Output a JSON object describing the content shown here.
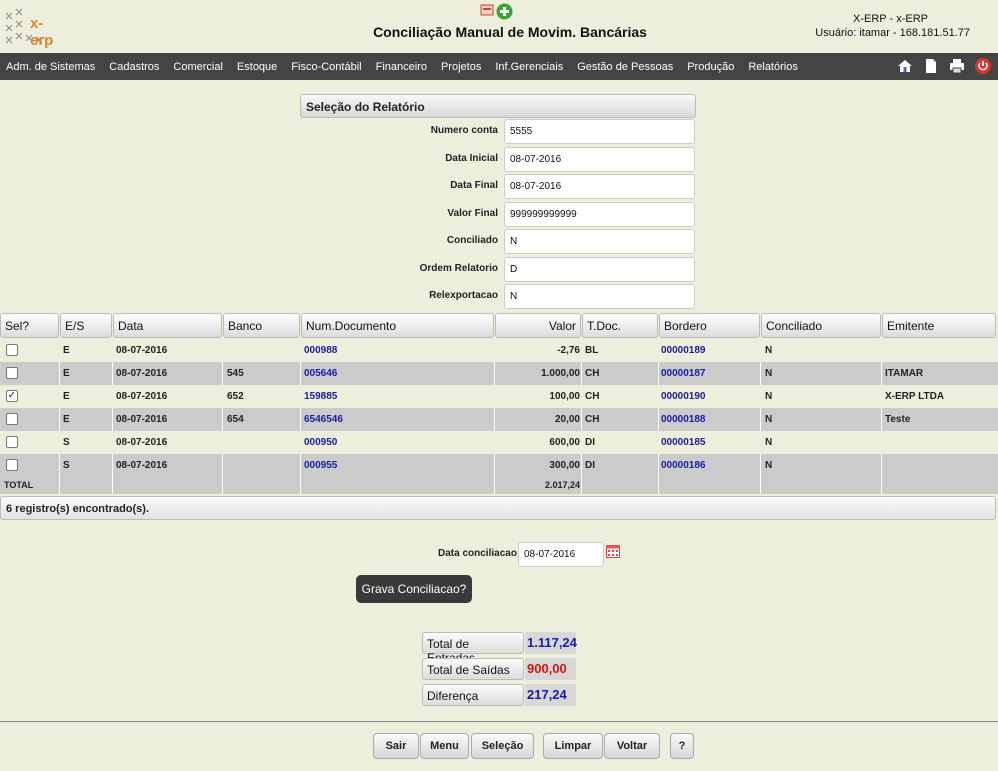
{
  "header": {
    "logo_text": "x-erp",
    "title": "Conciliação Manual de Movim. Bancárias",
    "system": "X-ERP - x-ERP",
    "user": "Usuário: itamar - 168.181.51.77"
  },
  "menu": [
    "Adm. de Sistemas",
    "Cadastros",
    "Comercial",
    "Estoque",
    "Fisco-Contábil",
    "Financeiro",
    "Projetos",
    "Inf.Gerenciais",
    "Gestão de Pessoas",
    "Produção",
    "Relatórios"
  ],
  "section_title": "Seleção do Relatório",
  "form": {
    "numero_conta_label": "Numero conta",
    "numero_conta": "5555",
    "data_inicial_label": "Data Inicial",
    "data_inicial": "08-07-2016",
    "data_final_label": "Data Final",
    "data_final": "08-07-2016",
    "valor_final_label": "Valor Final",
    "valor_final": "999999999999",
    "conciliado_label": "Conciliado",
    "conciliado": "N",
    "ordem_label": "Ordem Relatorio",
    "ordem": "D",
    "relexp_label": "Relexportacao",
    "relexp": "N"
  },
  "table": {
    "headers": [
      "Sel?",
      "E/S",
      "Data",
      "Banco",
      "Num.Documento",
      "Valor",
      "T.Doc.",
      "Bordero",
      "Conciliado",
      "Emitente"
    ],
    "rows": [
      {
        "checked": "",
        "es": "E",
        "data": "08-07-2016",
        "banco": "",
        "doc": "000988",
        "valor": "-2,76",
        "tdoc": "BL",
        "bordero": "00000189",
        "conciliado": "N",
        "emitente": ""
      },
      {
        "checked": "",
        "es": "E",
        "data": "08-07-2016",
        "banco": "545",
        "doc": "005646",
        "valor": "1.000,00",
        "tdoc": "CH",
        "bordero": "00000187",
        "conciliado": "N",
        "emitente": "ITAMAR"
      },
      {
        "checked": "✓",
        "es": "E",
        "data": "08-07-2016",
        "banco": "652",
        "doc": "159885",
        "valor": "100,00",
        "tdoc": "CH",
        "bordero": "00000190",
        "conciliado": "N",
        "emitente": "X-ERP LTDA"
      },
      {
        "checked": "",
        "es": "E",
        "data": "08-07-2016",
        "banco": "654",
        "doc": "6546546",
        "valor": "20,00",
        "tdoc": "CH",
        "bordero": "00000188",
        "conciliado": "N",
        "emitente": "Teste"
      },
      {
        "checked": "",
        "es": "S",
        "data": "08-07-2016",
        "banco": "",
        "doc": "000950",
        "valor": "600,00",
        "tdoc": "DI",
        "bordero": "00000185",
        "conciliado": "N",
        "emitente": ""
      },
      {
        "checked": "",
        "es": "S",
        "data": "08-07-2016",
        "banco": "",
        "doc": "000955",
        "valor": "300,00",
        "tdoc": "DI",
        "bordero": "00000186",
        "conciliado": "N",
        "emitente": ""
      }
    ],
    "total_label": "TOTAL",
    "total_value": "2.017,24"
  },
  "found_text": "6 registro(s) encontrado(s).",
  "data_conciliacao_label": "Data conciliacao",
  "data_conciliacao": "08-07-2016",
  "grava_label": "Grava Conciliacao?",
  "totals": {
    "entradas_label": "Total de Entradas",
    "entradas": "1.117,24",
    "saidas_label": "Total de Saídas",
    "saidas": "900,00",
    "diferenca_label": "Diferença",
    "diferenca": "217,24"
  },
  "colors": {
    "positive": "#1a1aa8",
    "negative": "#e01010"
  },
  "buttons": {
    "sair": "Sair",
    "menu": "Menu",
    "selecao": "Seleção",
    "limpar": "Limpar",
    "voltar": "Voltar",
    "help": "?"
  }
}
